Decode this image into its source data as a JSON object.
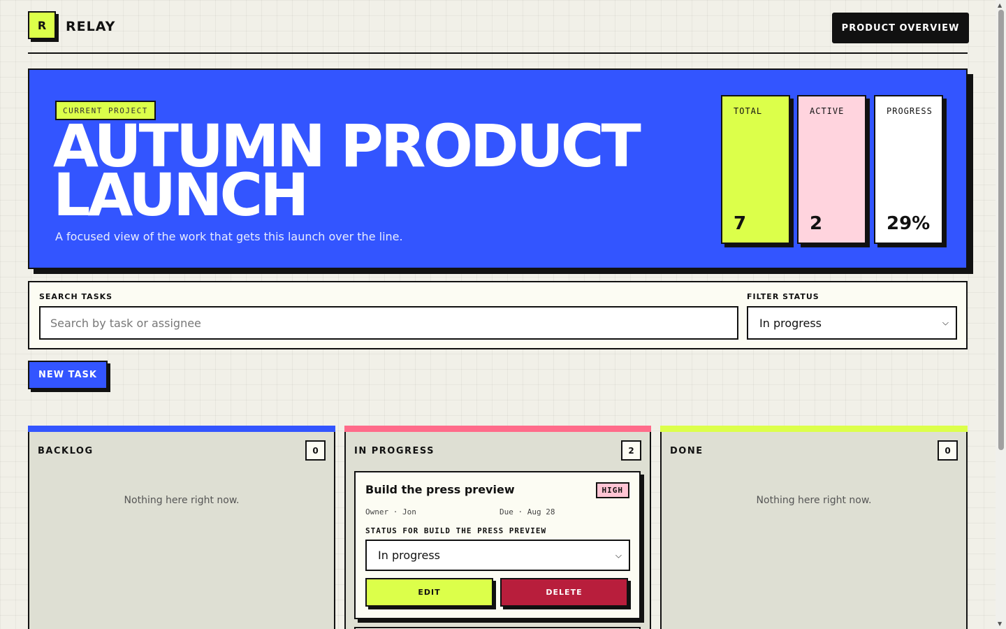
{
  "app": {
    "logo_letter": "R",
    "name": "RELAY"
  },
  "header": {
    "overview_label": "PRODUCT OVERVIEW"
  },
  "hero": {
    "tag": "CURRENT PROJECT",
    "title_line1": "AUTUMN PRODUCT",
    "title_line2": "LAUNCH",
    "subtitle": "A focused view of the work that gets this launch over the line.",
    "stats": [
      {
        "label": "TOTAL",
        "value": "7"
      },
      {
        "label": "ACTIVE",
        "value": "2"
      },
      {
        "label": "PROGRESS",
        "value": "29%"
      }
    ]
  },
  "filters": {
    "search_label": "SEARCH TASKS",
    "search_placeholder": "Search by task or assignee",
    "search_value": "",
    "status_label": "FILTER STATUS",
    "status_value": "In progress"
  },
  "actions": {
    "new_task_label": "NEW TASK"
  },
  "columns": [
    {
      "name": "BACKLOG",
      "count": "0",
      "empty_text": "Nothing here right now.",
      "color": "#3355ff"
    },
    {
      "name": "IN PROGRESS",
      "count": "2",
      "color": "#ff6b8a",
      "cards": [
        {
          "title": "Build the press preview",
          "priority": "HIGH",
          "owner": "Owner · Jon",
          "due": "Due · Aug 28",
          "status_label": "STATUS FOR BUILD THE PRESS PREVIEW",
          "status_value": "In progress",
          "edit_label": "EDIT",
          "delete_label": "DELETE"
        }
      ]
    },
    {
      "name": "DONE",
      "count": "0",
      "empty_text": "Nothing here right now.",
      "color": "#dcff4a"
    }
  ],
  "colors": {
    "accent": "#3355ff",
    "lime": "#dcff4a",
    "pink": "#ffd4de",
    "danger": "#b81e3c"
  }
}
